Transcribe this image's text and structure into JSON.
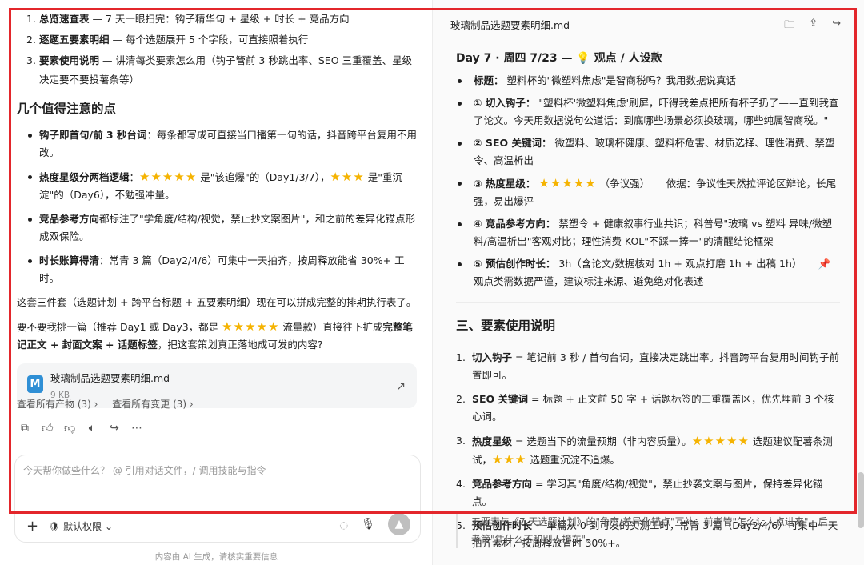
{
  "chat": {
    "top_list": [
      {
        "num": "1.",
        "bold": "总览速查表",
        "rest": " — 7 天一眼扫完：钩子精华句 + 星级 + 时长 + 竞品方向"
      },
      {
        "num": "2.",
        "bold": "逐题五要素明细",
        "rest": " — 每个选题展开 5 个字段，可直接照着执行"
      },
      {
        "num": "3.",
        "bold": "要素使用说明",
        "rest": " — 讲清每类要素怎么用（钩子管前 3 秒跳出率、SEO 三重覆盖、星级决定要不要投薯条等）"
      }
    ],
    "section_title": "几个值得注意的点",
    "points": [
      {
        "bold": "钩子即首句/前 3 秒台词",
        "rest": "：每条都写成可直接当口播第一句的话，抖音跨平台复用不用改。"
      },
      {
        "bold": "热度星级分两档逻辑",
        "rest_a": "：",
        "stars_a": "★★★★★",
        "rest_b": " 是\"该追爆\"的（Day1/3/7），",
        "stars_b": "★★★",
        "rest_c": " 是\"重沉淀\"的（Day6），不勉强冲量。"
      },
      {
        "bold": "竞品参考方向",
        "rest": "都标注了\"学角度/结构/视觉，禁止抄文案图片\"，和之前的差异化锚点形成双保险。"
      },
      {
        "bold": "时长账算得清",
        "rest": "：常青 3 篇（Day2/4/6）可集中一天拍齐，按周释放能省 30%+ 工时。"
      }
    ],
    "para1": "这套三件套（选题计划 + 跨平台标题 + 五要素明细）现在可以拼成完整的排期执行表了。",
    "para2_a": "要不要我挑一篇（推荐 Day1 或 Day3，都是 ",
    "para2_stars": "★★★★★",
    "para2_b": " 流量款）直接往下扩成",
    "para2_bold": "完整笔记正文 + 封面文案 + 话题标签",
    "para2_c": "，把这套策划真正落地成可发的内容?",
    "file": {
      "icon_letter": "M",
      "name": "玻璃制品选题要素明细.md",
      "size": "9 KB"
    },
    "link_outputs": "查看所有产物 (3) ›",
    "link_changes": "查看所有变更 (3) ›",
    "input_placeholder": "今天帮你做些什么？ @ 引用对话文件，/ 调用技能与指令",
    "permission_label": "默认权限",
    "footer": "内容由 AI 生成，请核实重要信息"
  },
  "doc": {
    "title": "玻璃制品选题要素明细.md",
    "day_title": "Day 7 · 周四 7/23 — ",
    "day_title_suffix": "观点 / 人设款",
    "items": [
      {
        "label": "标题：",
        "text": "塑料杯的\"微塑料焦虑\"是智商税吗？我用数据说真话"
      },
      {
        "label": "① 切入钩子：",
        "text": "\"塑料杯'微塑料焦虑'刷屏，吓得我差点把所有杯子扔了——直到我查了论文。今天用数据说句公道话：到底哪些场景必须换玻璃，哪些纯属智商税。\""
      },
      {
        "label": "② SEO 关键词：",
        "text": "微塑料、玻璃杯健康、塑料杯危害、材质选择、理性消费、禁塑令、高温析出"
      },
      {
        "label": "③ 热度星级：",
        "stars": "★★★★★",
        "text": "（争议强） ｜ 依据：争议性天然拉评论区辩论，长尾强，易出爆评"
      },
      {
        "label": "④ 竞品参考方向：",
        "text": "禁塑令 + 健康叙事行业共识；科普号\"玻璃 vs 塑料 异味/微塑料/高温析出\"客观对比；理性消费 KOL\"不踩一捧一\"的清醒结论框架"
      },
      {
        "label": "⑤ 预估创作时长：",
        "text": "3h（含论文/数据核对 1h + 观点打磨 1h + 出稿 1h） ｜ ",
        "pin": "📌",
        "text2": " 观点类需数据严谨，建议标注来源、避免绝对化表述"
      }
    ],
    "usage_title": "三、要素使用说明",
    "usage": [
      {
        "num": "1.",
        "bold": "切入钩子",
        "text": " = 笔记前 3 秒 / 首句台词，直接决定跳出率。抖音跨平台复用时间钩子前置即可。"
      },
      {
        "num": "2.",
        "bold": "SEO 关键词",
        "text": " = 标题 + 正文前 50 字 + 话题标签的三重覆盖区，优先埋前 3 个核心词。"
      },
      {
        "num": "3.",
        "bold": "热度星级",
        "text_a": " = 选题当下的流量预期（非内容质量）。",
        "stars_a": "★★★★★",
        "text_b": " 选题建议配薯条测试，",
        "stars_b": "★★★",
        "text_c": " 选题重沉淀不追爆。"
      },
      {
        "num": "4.",
        "bold": "竞品参考方向",
        "text": " = 学习其\"角度/结构/视觉\"，禁止抄袭文案与图片，保持差异化锚点。"
      },
      {
        "num": "5.",
        "bold": "预估创作时长",
        "text": " = 单篇从 0 到可发的实测工时，常青 3 篇（Day2/4/6）可集中一天拍齐素材，按周释放省时 30%+。"
      }
    ],
    "quote": "五要素与《7 天选题计划》的\"角度/差异化锚点\"互补：前者管\"怎么让人点进来\"，后者管\"凭什么不和别人撞车\"。"
  },
  "colors": {
    "highlight_frame": "#e3262b",
    "star": "#f5b301",
    "file_icon": "#2f8fd5"
  }
}
